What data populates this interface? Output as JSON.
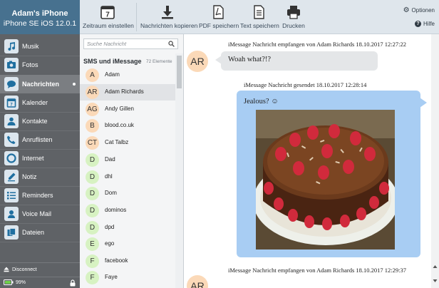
{
  "device": {
    "name": "Adam's iPhone",
    "model": "iPhone SE iOS 12.0.1"
  },
  "toolbar": {
    "timeline": "Zeitraum einstellen",
    "copy": "Nachrichten kopieren",
    "pdf": "PDF speichern",
    "text": "Text speichern",
    "print": "Drucken",
    "calendar_day": "7",
    "options": "Optionen",
    "help": "Hilfe"
  },
  "nav": {
    "items": [
      {
        "label": "Musik",
        "icon": "music-icon"
      },
      {
        "label": "Fotos",
        "icon": "photos-icon"
      },
      {
        "label": "Nachrichten",
        "icon": "messages-icon",
        "active": true
      },
      {
        "label": "Kalender",
        "icon": "calendar-icon"
      },
      {
        "label": "Kontakte",
        "icon": "contacts-icon"
      },
      {
        "label": "Anruflisten",
        "icon": "call-log-icon"
      },
      {
        "label": "Internet",
        "icon": "internet-icon"
      },
      {
        "label": "Notiz",
        "icon": "notes-icon"
      },
      {
        "label": "Reminders",
        "icon": "reminders-icon"
      },
      {
        "label": "Voice Mail",
        "icon": "voicemail-icon"
      },
      {
        "label": "Dateien",
        "icon": "files-icon"
      }
    ],
    "disconnect": "Disconnect",
    "battery": "99%"
  },
  "list": {
    "search_placeholder": "Suche Nachricht",
    "section": "SMS und iMessage",
    "count": "72 Elemente",
    "contacts": [
      {
        "initials": "A",
        "name": "Adam",
        "color": "orange"
      },
      {
        "initials": "AR",
        "name": "Adam Richards",
        "color": "orange",
        "selected": true
      },
      {
        "initials": "AG",
        "name": "Andy Gillen",
        "color": "orange"
      },
      {
        "initials": "B",
        "name": "blood.co.uk",
        "color": "orange"
      },
      {
        "initials": "CT",
        "name": "Cat Talbz",
        "color": "orange"
      },
      {
        "initials": "D",
        "name": "Dad",
        "color": "green"
      },
      {
        "initials": "D",
        "name": "dhl",
        "color": "green"
      },
      {
        "initials": "D",
        "name": "Dom",
        "color": "green"
      },
      {
        "initials": "D",
        "name": "dominos",
        "color": "green"
      },
      {
        "initials": "D",
        "name": "dpd",
        "color": "green"
      },
      {
        "initials": "E",
        "name": "ego",
        "color": "green"
      },
      {
        "initials": "F",
        "name": "facebook",
        "color": "green"
      },
      {
        "initials": "F",
        "name": "Faye",
        "color": "green"
      }
    ]
  },
  "chat": {
    "msg1_meta": "iMessage Nachricht empfangen von Adam Richards 18.10.2017 12:27:22",
    "msg1_avatar": "AR",
    "msg1_text": "Woah what?!?",
    "msg2_meta": "iMessage Nachricht gesendet 18.10.2017 12:28:14",
    "msg2_text": "Jealous? ☺",
    "msg3_meta": "iMessage Nachricht empfangen von Adam Richards 18.10.2017 12:29:37"
  },
  "colors": {
    "header": "#47718f",
    "nav": "#5f6266",
    "sent_bubble": "#a8cdf3",
    "recv_bubble": "#e4e6e8"
  }
}
